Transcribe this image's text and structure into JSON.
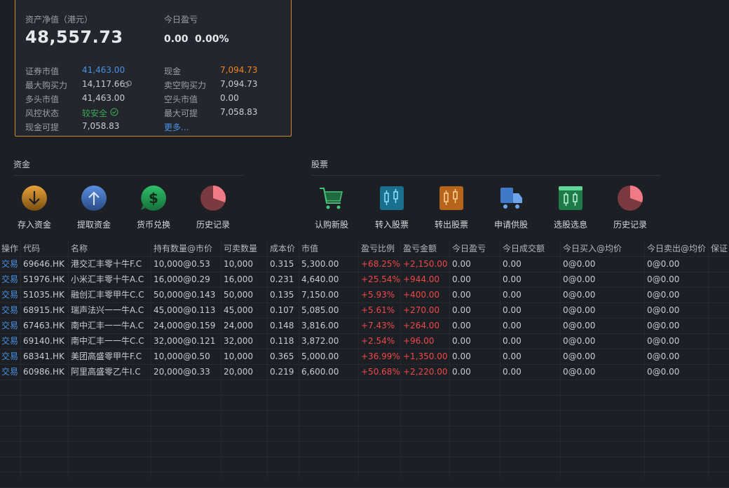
{
  "summary": {
    "net_asset_label": "资产净值（港元）",
    "net_asset_value": "48,557.73",
    "today_pnl_label": "今日盈亏",
    "today_pnl_value": "0.00",
    "today_pnl_pct": "0.00%",
    "rows": [
      {
        "l1": "证券市值",
        "v1": "41,463.00",
        "l2": "现金",
        "v2": "7,094.73"
      },
      {
        "l1": "最大购买力",
        "v1": "14,117.66",
        "l2": "卖空购买力",
        "v2": "7,094.73"
      },
      {
        "l1": "多头市值",
        "v1": "41,463.00",
        "l2": "空头市值",
        "v2": "0.00"
      },
      {
        "l1": "风控状态",
        "v1": "较安全",
        "l2": "最大可提",
        "v2": "7,058.83"
      },
      {
        "l1": "现金可提",
        "v1": "7,058.83",
        "l2": "更多...",
        "v2": ""
      }
    ]
  },
  "funds": {
    "title": "资金",
    "actions": [
      "存入资金",
      "提取资金",
      "货币兑换",
      "历史记录"
    ]
  },
  "stocks": {
    "title": "股票",
    "actions": [
      "认购新股",
      "转入股票",
      "转出股票",
      "申请供股",
      "选股选息",
      "历史记录"
    ]
  },
  "table": {
    "headers": [
      "操作",
      "代码",
      "名称",
      "持有数量@市价",
      "可卖数量",
      "成本价",
      "市值",
      "盈亏比例",
      "盈亏金额",
      "今日盈亏",
      "今日成交额",
      "今日买入@均价",
      "今日卖出@均价",
      "保证"
    ],
    "rows": [
      [
        "交易",
        "69646.HK",
        "港交汇丰零十牛F.C",
        "10,000@0.53",
        "10,000",
        "0.315",
        "5,300.00",
        "+68.25%",
        "+2,150.00",
        "0.00",
        "0.00",
        "0@0.00",
        "0@0.00"
      ],
      [
        "交易",
        "51976.HK",
        "小米汇丰零十牛A.C",
        "16,000@0.29",
        "16,000",
        "0.231",
        "4,640.00",
        "+25.54%",
        "+944.00",
        "0.00",
        "0.00",
        "0@0.00",
        "0@0.00"
      ],
      [
        "交易",
        "51035.HK",
        "融创汇丰零甲牛C.C",
        "50,000@0.143",
        "50,000",
        "0.135",
        "7,150.00",
        "+5.93%",
        "+400.00",
        "0.00",
        "0.00",
        "0@0.00",
        "0@0.00"
      ],
      [
        "交易",
        "68915.HK",
        "瑞声法兴一一牛A.C",
        "45,000@0.113",
        "45,000",
        "0.107",
        "5,085.00",
        "+5.61%",
        "+270.00",
        "0.00",
        "0.00",
        "0@0.00",
        "0@0.00"
      ],
      [
        "交易",
        "67463.HK",
        "南中汇丰一一牛A.C",
        "24,000@0.159",
        "24,000",
        "0.148",
        "3,816.00",
        "+7.43%",
        "+264.00",
        "0.00",
        "0.00",
        "0@0.00",
        "0@0.00"
      ],
      [
        "交易",
        "69140.HK",
        "南中汇丰一一牛C.C",
        "32,000@0.121",
        "32,000",
        "0.118",
        "3,872.00",
        "+2.54%",
        "+96.00",
        "0.00",
        "0.00",
        "0@0.00",
        "0@0.00"
      ],
      [
        "交易",
        "68341.HK",
        "美团高盛零甲牛F.C",
        "10,000@0.50",
        "10,000",
        "0.365",
        "5,000.00",
        "+36.99%",
        "+1,350.00",
        "0.00",
        "0.00",
        "0@0.00",
        "0@0.00"
      ],
      [
        "交易",
        "60986.HK",
        "阿里高盛零乙牛I.C",
        "20,000@0.33",
        "20,000",
        "0.219",
        "6,600.00",
        "+50.68%",
        "+2,220.00",
        "0.00",
        "0.00",
        "0@0.00",
        "0@0.00"
      ]
    ]
  },
  "colors": {
    "accent_border": "#c98a2c",
    "link": "#4a90e2",
    "profit": "#f0484b",
    "cash": "#f0861a",
    "safe": "#3aa757"
  }
}
